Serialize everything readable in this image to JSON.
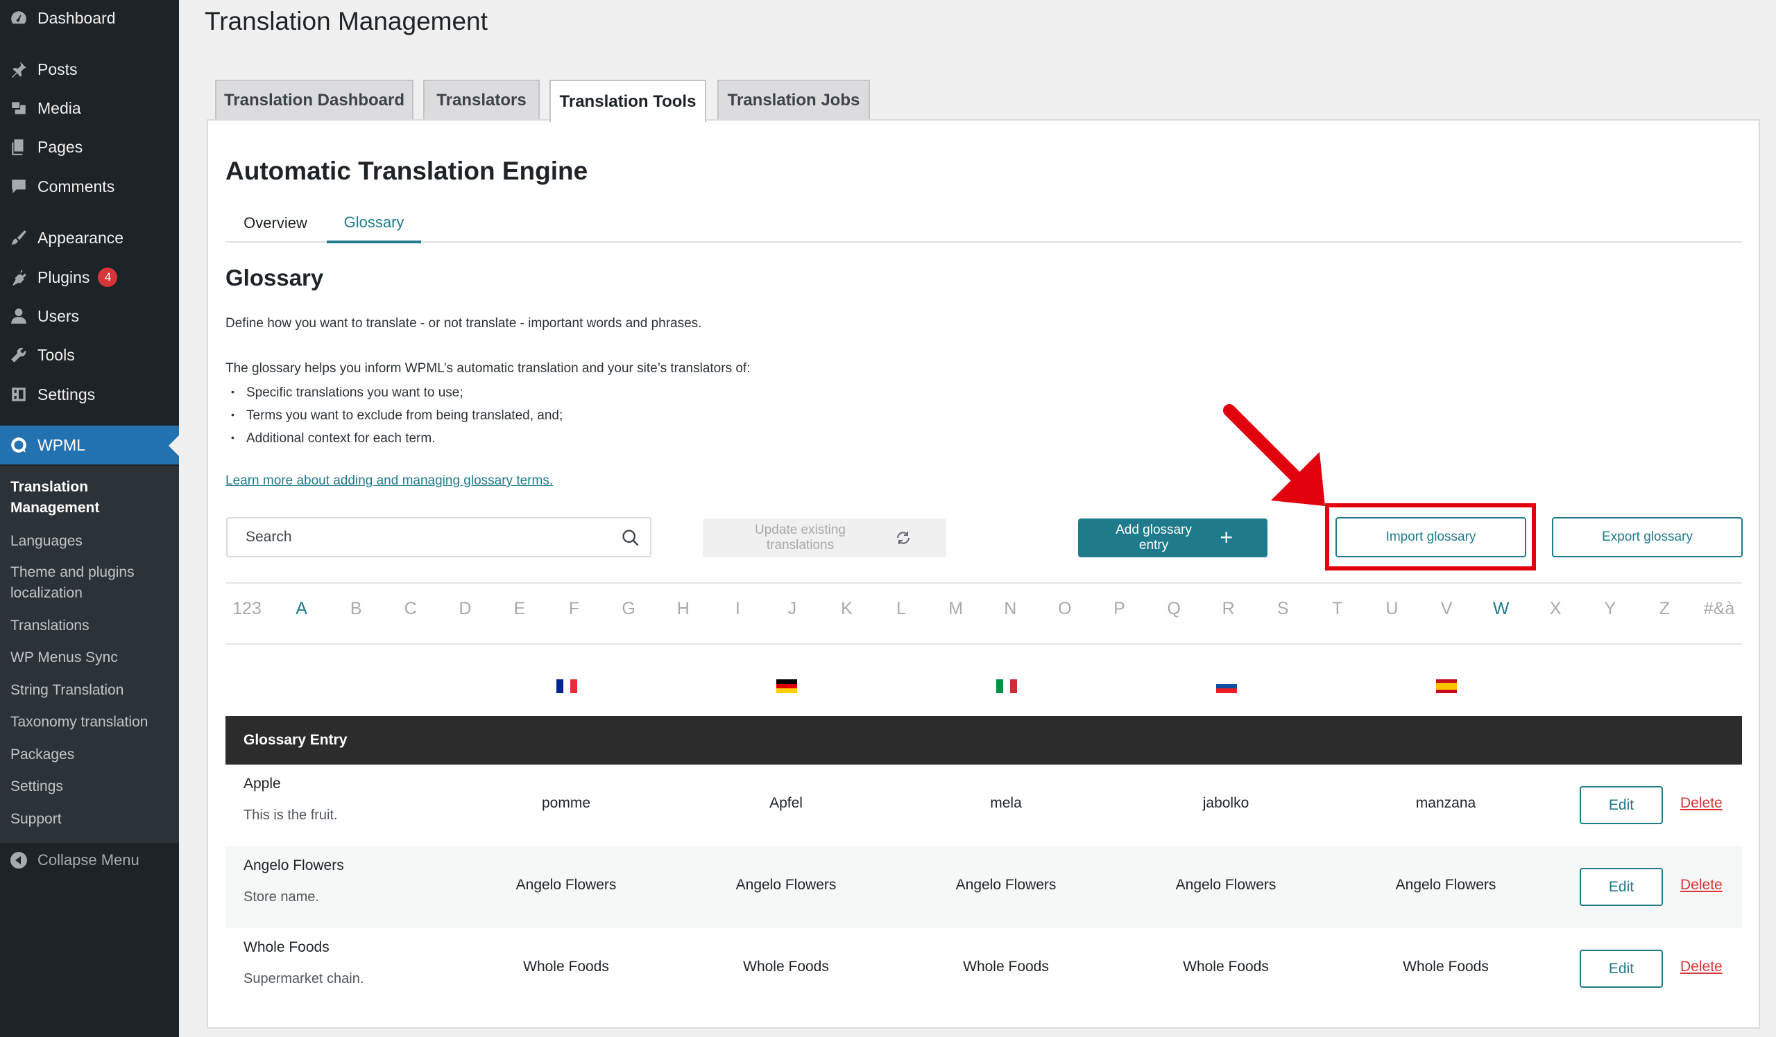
{
  "sidebar": {
    "items": [
      {
        "label": "Dashboard",
        "icon": "dashboard-icon"
      },
      {
        "label": "Posts",
        "icon": "pin-icon"
      },
      {
        "label": "Media",
        "icon": "media-icon"
      },
      {
        "label": "Pages",
        "icon": "pages-icon"
      },
      {
        "label": "Comments",
        "icon": "comment-icon"
      },
      {
        "label": "Appearance",
        "icon": "brush-icon"
      },
      {
        "label": "Plugins",
        "icon": "plugin-icon",
        "badge": "4"
      },
      {
        "label": "Users",
        "icon": "user-icon"
      },
      {
        "label": "Tools",
        "icon": "wrench-icon"
      },
      {
        "label": "Settings",
        "icon": "settings-icon"
      },
      {
        "label": "WPML",
        "icon": "wpml-icon"
      }
    ],
    "submenu": [
      "Translation Management",
      "Languages",
      "Theme and plugins localization",
      "Translations",
      "WP Menus Sync",
      "String Translation",
      "Taxonomy translation",
      "Packages",
      "Settings",
      "Support"
    ],
    "collapse_label": "Collapse Menu",
    "accent_color": "#2271b1"
  },
  "page": {
    "title": "Translation Management",
    "tabs": [
      "Translation Dashboard",
      "Translators",
      "Translation Tools",
      "Translation Jobs"
    ],
    "active_tab": "Translation Tools"
  },
  "engine": {
    "title": "Automatic Translation Engine",
    "subtabs": [
      "Overview",
      "Glossary"
    ],
    "active_subtab": "Glossary"
  },
  "glossary": {
    "title": "Glossary",
    "intro": "Define how you want to translate - or not translate - important words and phrases.",
    "helps": "The glossary helps you inform WPML’s automatic translation and your site’s translators of:",
    "bullets": [
      "Specific translations you want to use;",
      "Terms you want to exclude from being translated, and;",
      "Additional context for each term."
    ],
    "learn_more": "Learn more about adding and managing glossary terms.",
    "search_placeholder": "Search",
    "update_label": "Update existing translations",
    "add_label": "Add glossary entry",
    "import_label": "Import glossary",
    "export_label": "Export glossary",
    "alphabet": [
      "123",
      "A",
      "B",
      "C",
      "D",
      "E",
      "F",
      "G",
      "H",
      "I",
      "J",
      "K",
      "L",
      "M",
      "N",
      "O",
      "P",
      "Q",
      "R",
      "S",
      "T",
      "U",
      "V",
      "W",
      "X",
      "Y",
      "Z",
      "#&à"
    ],
    "alphabet_active": [
      "A",
      "W"
    ],
    "languages": [
      "french-flag",
      "german-flag",
      "italian-flag",
      "slovak-flag",
      "spanish-flag"
    ],
    "table_header": "Glossary Entry",
    "edit_label": "Edit",
    "delete_label": "Delete",
    "accent_color": "#1f7a8c",
    "rows": [
      {
        "term": "Apple",
        "desc": "This is the fruit.",
        "translations": [
          "pomme",
          "Apfel",
          "mela",
          "jabolko",
          "manzana"
        ]
      },
      {
        "term": "Angelo Flowers",
        "desc": "Store name.",
        "translations": [
          "Angelo Flowers",
          "Angelo Flowers",
          "Angelo Flowers",
          "Angelo Flowers",
          "Angelo Flowers"
        ]
      },
      {
        "term": "Whole Foods",
        "desc": "Supermarket chain.",
        "translations": [
          "Whole Foods",
          "Whole Foods",
          "Whole Foods",
          "Whole Foods",
          "Whole Foods"
        ]
      }
    ]
  }
}
